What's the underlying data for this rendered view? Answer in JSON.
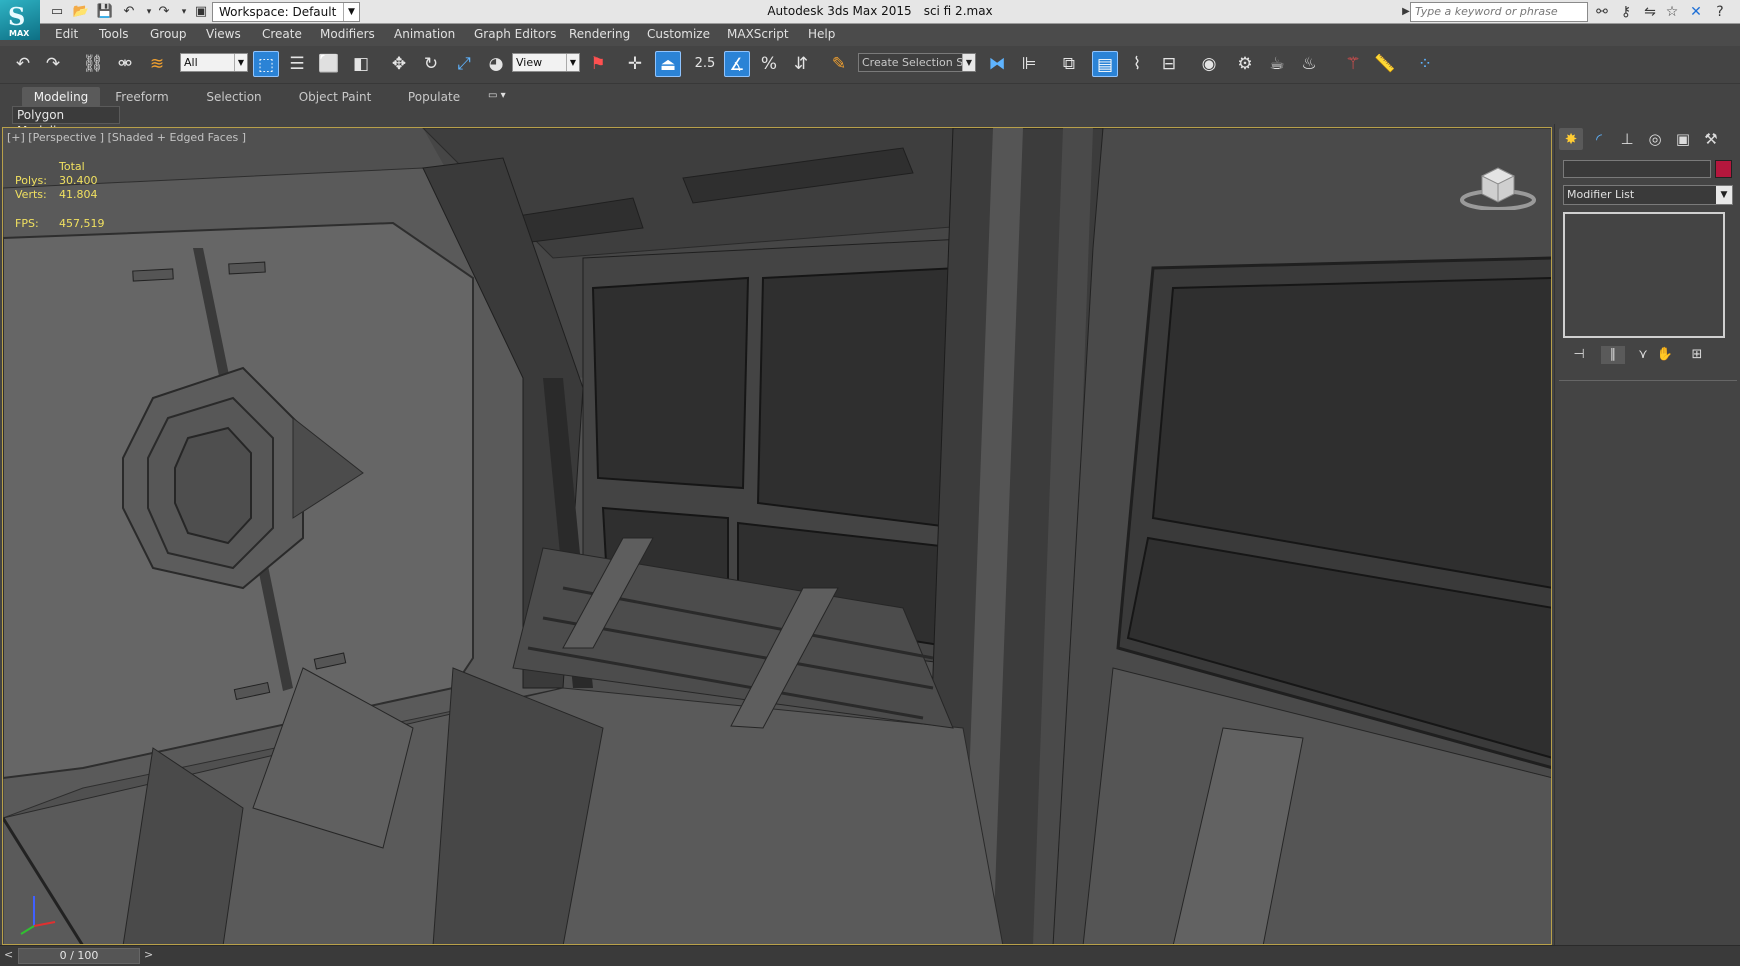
{
  "app": {
    "logo_label": "MAX",
    "window_title": "Autodesk 3ds Max  2015",
    "file_name": "sci fi 2.max",
    "workspace": "Workspace: Default",
    "search_placeholder": "Type a keyword or phrase"
  },
  "menu": {
    "items": [
      "Edit",
      "Tools",
      "Group",
      "Views",
      "Create",
      "Modifiers",
      "Animation",
      "Graph Editors",
      "Rendering",
      "Customize",
      "MAXScript",
      "Help"
    ]
  },
  "toolbar": {
    "selection_filter": "All",
    "ref_coord": "View",
    "snap_label": "2.5",
    "named_selection_placeholder": "Create Selection Se"
  },
  "ribbon": {
    "tabs": [
      "Modeling",
      "Freeform",
      "Selection",
      "Object Paint",
      "Populate"
    ],
    "active_tab": "Modeling",
    "panel_label": "Polygon Modeling"
  },
  "viewport": {
    "label": "[+] [Perspective ] [Shaded + Edged Faces ]",
    "stats_header": "Total",
    "polys_label": "Polys:",
    "polys_value": "30.400",
    "verts_label": "Verts:",
    "verts_value": "41.804",
    "fps_label": "FPS:",
    "fps_value": "457,519",
    "border_color": "#b8a04a"
  },
  "command_panel": {
    "modifier_list": "Modifier List",
    "object_color": "#b5173d"
  },
  "timeline": {
    "frame": "0 / 100",
    "prev": "<",
    "next": ">"
  }
}
